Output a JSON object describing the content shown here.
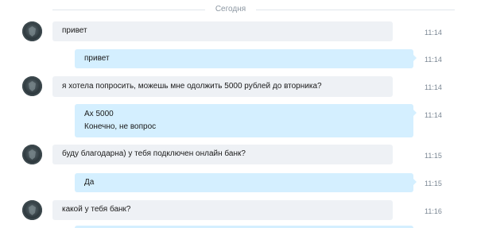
{
  "date_separator": "Сегодня",
  "messages": [
    {
      "direction": "in",
      "lines": [
        "привет"
      ],
      "time": "11:14"
    },
    {
      "direction": "out",
      "lines": [
        "привет"
      ],
      "time": "11:14"
    },
    {
      "direction": "in",
      "lines": [
        "я хотела попросить, можешь мне одолжить 5000 рублей до вторника?"
      ],
      "time": "11:14"
    },
    {
      "direction": "out",
      "lines": [
        "Ах 5000",
        "Конечно, не вопрос"
      ],
      "time": "11:14"
    },
    {
      "direction": "in",
      "lines": [
        "буду благодарна) у тебя подключен онлайн банк?"
      ],
      "time": "11:15"
    },
    {
      "direction": "out",
      "lines": [
        "Да"
      ],
      "time": "11:15"
    },
    {
      "direction": "in",
      "lines": [
        "какой у тебя банк?"
      ],
      "time": "11:16"
    }
  ]
}
